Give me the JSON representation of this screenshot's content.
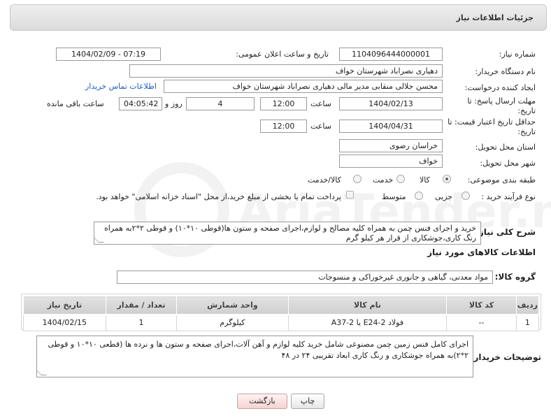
{
  "header": {
    "title": "جزئیات اطلاعات نیاز"
  },
  "form": {
    "need_number_label": "شماره نیاز:",
    "need_number": "1104096444000001",
    "announce_label": "تاریخ و ساعت اعلان عمومی:",
    "announce_value": "1404/02/09 - 07:19",
    "buyer_org_label": "نام دستگاه خریدار:",
    "buyer_org": "دهیاری نصراباد شهرستان خواف",
    "requester_label": "ایجاد کننده درخواست:",
    "requester": "محسن جلالی منقابی مدیر مالی دهیاری نصراباد شهرستان خواف",
    "contact_link": "اطلاعات تماس خریدار",
    "deadline_label": "مهلت ارسال پاسخ: تا تاریخ:",
    "deadline_date": "1404/02/13",
    "time_label": "ساعت",
    "deadline_time": "12:00",
    "days_value": "4",
    "days_label": "روز و",
    "remaining_time": "04:05:42",
    "remaining_label": "ساعت باقی مانده",
    "validity_label": "حداقل تاریخ اعتبار قیمت: تا تاریخ:",
    "validity_date": "1404/04/31",
    "validity_time": "12:00",
    "province_label": "استان محل تحویل:",
    "province": "خراسان رضوی",
    "city_label": "شهر محل تحویل:",
    "city": "خواف",
    "category_label": "طبقه بندی موضوعی:",
    "category_options": [
      "کالا",
      "خدمت",
      "کالا/خدمت"
    ],
    "category_selected": "کالا",
    "process_label": "نوع فرآیند خرید :",
    "process_options": [
      "جزیی",
      "متوسط"
    ],
    "payment_note": "پرداخت تمام یا بخشی از مبلغ خرید،از محل \"اسناد خزانه اسلامی\" خواهد بود."
  },
  "description": {
    "label": "شرح کلی نیاز:",
    "text": "خرید و اجرای فنس چمن به همراه کلیه مصالح و لوازم،اجرای صفحه و ستون ها(قوطی ۱۰*۱۰) و قوطی ۲*۲به همراه رنگ کاری،جوشکاری از قرار هر کیلو گرم"
  },
  "goods_section": {
    "title": "اطلاعات کالاهای مورد نیاز",
    "group_label": "گروه کالا:",
    "group_value": "مواد معدنی، گیاهی و جانوری غیرخوراکی و منسوجات"
  },
  "table": {
    "columns": [
      "ردیف",
      "کد کالا",
      "نام کالا",
      "واحد شمارش",
      "تعداد / مقدار",
      "تاریخ نیاز"
    ],
    "rows": [
      [
        "1",
        "--",
        "فولاد E24-2 یا A37-2",
        "کیلوگرم",
        "1",
        "1404/02/15"
      ]
    ]
  },
  "buyer_notes": {
    "label": "توضیحات خریدار:",
    "text": "اجرای کامل فنس زمین چمن مصنوعی شامل خرید کلیه لوازم و آهن آلات،اجرای صفحه و ستون ها و نرده ها (قطعی ۱۰*۱۰ و قوطی ۲*۲)به همراه جوشکاری و رنگ کاری ابعاد تقریبی ۲۴ در ۴۸"
  },
  "buttons": {
    "print": "چاپ",
    "back": "بازگشت"
  },
  "watermark_text": "AriaTender.neT"
}
